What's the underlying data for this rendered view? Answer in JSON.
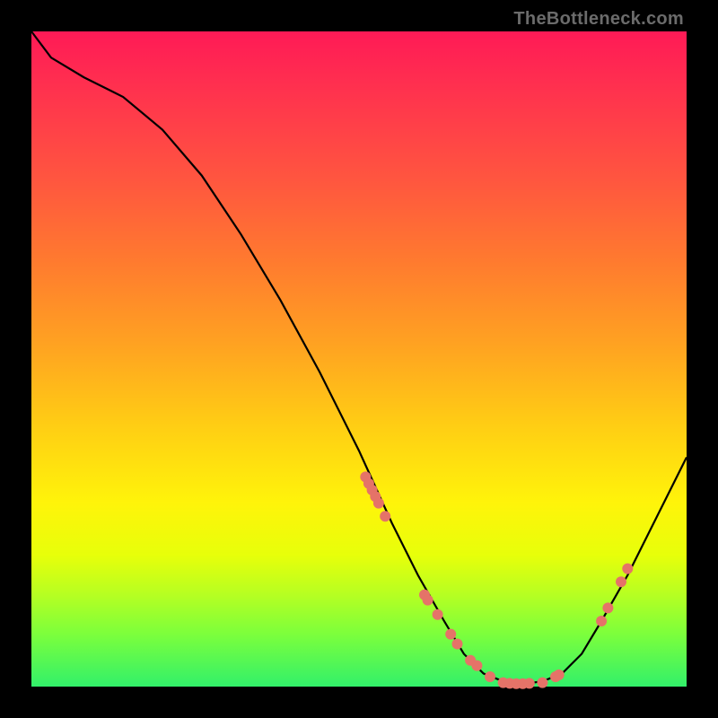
{
  "watermark": "TheBottleneck.com",
  "chart_data": {
    "type": "line",
    "title": "",
    "xlabel": "",
    "ylabel": "",
    "xlim": [
      0,
      100
    ],
    "ylim": [
      0,
      100
    ],
    "grid": false,
    "legend": false,
    "series": [
      {
        "name": "curve",
        "color": "#000000",
        "x": [
          0,
          3,
          8,
          14,
          20,
          26,
          32,
          38,
          44,
          50,
          55,
          59,
          63,
          66,
          69,
          72,
          75,
          78,
          81,
          84,
          87,
          91,
          95,
          100
        ],
        "y": [
          100,
          96,
          93,
          90,
          85,
          78,
          69,
          59,
          48,
          36,
          25,
          17,
          10,
          5,
          2,
          0.8,
          0.4,
          0.8,
          2,
          5,
          10,
          17,
          25,
          35
        ]
      }
    ],
    "points": {
      "name": "markers",
      "color": "#e57368",
      "x": [
        51,
        51.5,
        52,
        52.5,
        53,
        54,
        60,
        60.5,
        62,
        64,
        65,
        67,
        68,
        70,
        72,
        73,
        74,
        75,
        76,
        78,
        80,
        80.5,
        87,
        88,
        90,
        91
      ],
      "y": [
        32,
        31,
        30,
        29,
        28,
        26,
        14,
        13.2,
        11,
        8,
        6.5,
        4,
        3.2,
        1.5,
        0.6,
        0.5,
        0.45,
        0.45,
        0.5,
        0.6,
        1.5,
        1.8,
        10,
        12,
        16,
        18
      ]
    },
    "gradient_stops": [
      {
        "pos": 0.0,
        "color": "#ff1a56"
      },
      {
        "pos": 0.35,
        "color": "#ff7a2f"
      },
      {
        "pos": 0.6,
        "color": "#ffcd14"
      },
      {
        "pos": 0.8,
        "color": "#e7ff0a"
      },
      {
        "pos": 1.0,
        "color": "#32f06a"
      }
    ]
  }
}
